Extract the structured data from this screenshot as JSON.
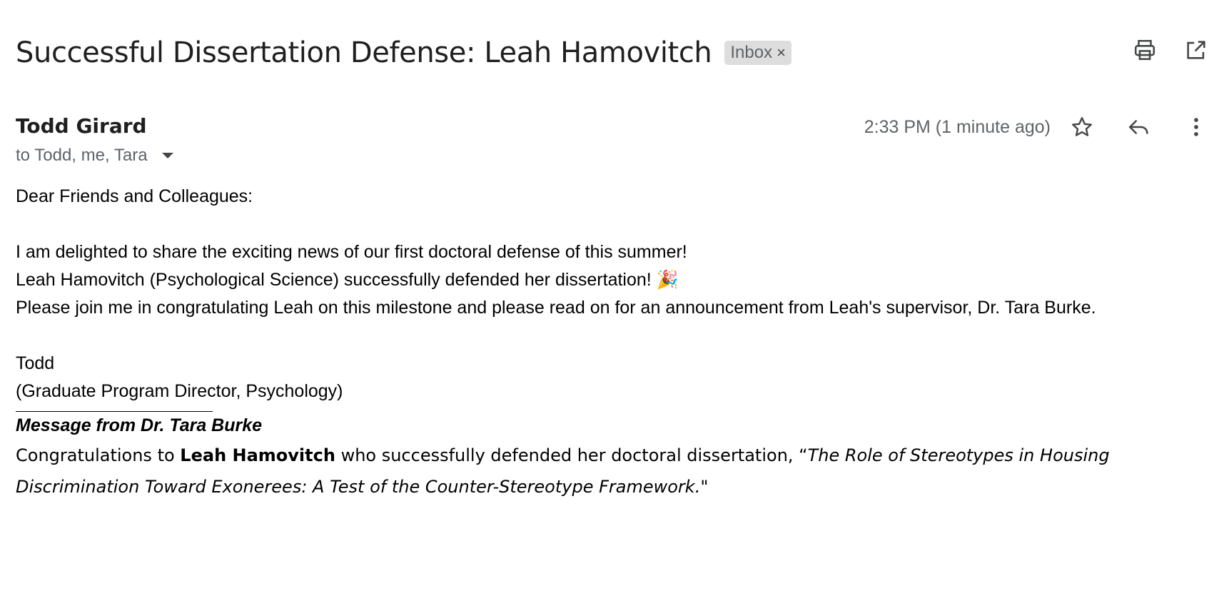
{
  "subject": "Successful Dissertation Defense: Leah Hamovitch",
  "label": {
    "name": "Inbox",
    "remove_glyph": "×"
  },
  "toolbar": {
    "print_icon": "print-icon",
    "open_new_window_icon": "open-in-new-window-icon"
  },
  "message": {
    "sender": "Todd Girard",
    "recipients": "to Todd, me, Tara",
    "timestamp": "2:33 PM (1 minute ago)",
    "star_icon": "star-icon",
    "reply_icon": "reply-icon",
    "more_icon": "more-vertical-icon"
  },
  "body": {
    "greeting": "Dear Friends and Colleagues:",
    "line1": "I am delighted to share the exciting news of our first doctoral defense of this summer!",
    "line2": "Leah Hamovitch (Psychological Science) successfully defended her dissertation!",
    "line2_emoji": "🎉",
    "line3": "Please join me in congratulating Leah on this milestone and please read on for an announcement from Leah's supervisor, Dr. Tara Burke.",
    "signoff": "Todd",
    "signoff_title": "(Graduate Program Director, Psychology)",
    "burke_heading": "Message from Dr. Tara Burke",
    "burke_intro": "Congratulations to ",
    "burke_name": "Leah Hamovitch",
    "burke_mid": " who successfully defended her doctoral dissertation, “",
    "burke_title": "The Role of Stereotypes in Housing Discrimination Toward Exonerees: A Test of the Counter-Stereotype Framework.",
    "burke_end": "\""
  },
  "colors": {
    "chip_bg": "#dddddd",
    "muted_text": "#5f6368",
    "icon": "#444746"
  }
}
